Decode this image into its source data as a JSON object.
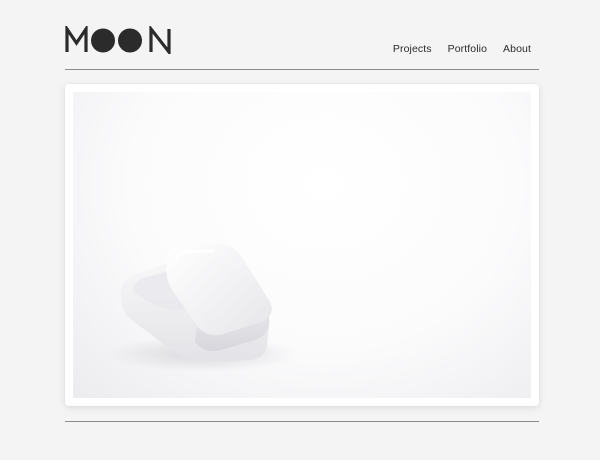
{
  "brand": {
    "logo_text": "MOON"
  },
  "nav": {
    "items": [
      {
        "label": "Projects"
      },
      {
        "label": "Portfolio"
      },
      {
        "label": "About"
      }
    ]
  },
  "hero": {
    "image_icon": "product-photo-soap-dish",
    "colors": {
      "page_bg": "#f4f4f4",
      "rule": "#8c8c8c",
      "text": "#2b2b2b"
    }
  }
}
